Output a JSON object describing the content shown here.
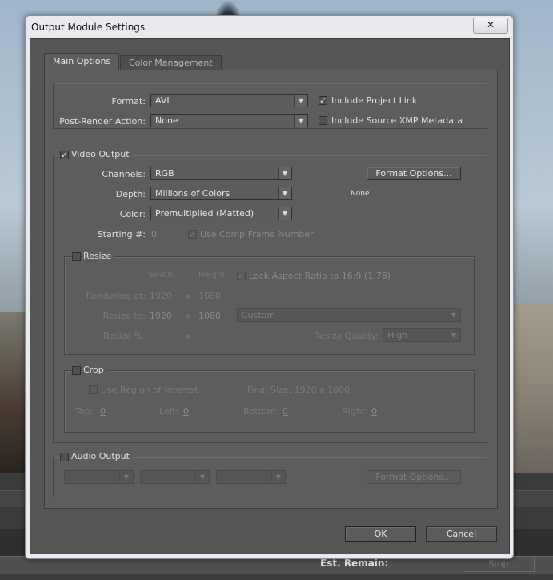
{
  "window": {
    "title": "Output Module Settings",
    "close_label": "✕"
  },
  "tabs": [
    {
      "label": "Main Options"
    },
    {
      "label": "Color Management"
    }
  ],
  "format_section": {
    "format_label": "Format:",
    "format_value": "AVI",
    "post_render_label": "Post-Render Action:",
    "post_render_value": "None",
    "include_project_link_label": "Include Project Link",
    "include_project_link_checked": true,
    "include_xmp_label": "Include Source XMP Metadata",
    "include_xmp_checked": false
  },
  "video_output": {
    "label": "Video Output",
    "checked": true,
    "channels_label": "Channels:",
    "channels_value": "RGB",
    "depth_label": "Depth:",
    "depth_value": "Millions of Colors",
    "color_label": "Color:",
    "color_value": "Premultiplied (Matted)",
    "starting_label": "Starting #:",
    "starting_value": "0",
    "use_comp_frame_label": "Use Comp Frame Number",
    "format_options_label": "Format Options...",
    "codec_value": "None"
  },
  "resize": {
    "label": "Resize",
    "checked": false,
    "width_header": "Width",
    "height_header": "Height",
    "lock_aspect_label": "Lock Aspect Ratio to 16:9 (1.78)",
    "rendering_at_label": "Rendering at:",
    "rendering_w": "1920",
    "rendering_h": "1080",
    "x_sep": "x",
    "resize_to_label": "Resize to:",
    "resize_w": "1920",
    "resize_h": "1080",
    "preset_value": "Custom",
    "resize_pct_label": "Resize %:",
    "quality_label": "Resize Quality:",
    "quality_value": "High"
  },
  "crop": {
    "label": "Crop",
    "checked": false,
    "roi_label": "Use Region of Interest",
    "final_size_label": "Final Size: 1920 x 1080",
    "top_label": "Top:",
    "top_value": "0",
    "left_label": "Left:",
    "left_value": "0",
    "bottom_label": "Bottom:",
    "bottom_value": "0",
    "right_label": "Right:",
    "right_value": "0"
  },
  "audio_output": {
    "label": "Audio Output",
    "checked": false,
    "format_options_label": "Format Options..."
  },
  "buttons": {
    "ok": "OK",
    "cancel": "Cancel"
  },
  "background": {
    "status_text": "Est. Remain:",
    "stop_label": "Stop"
  },
  "icons": {
    "checkmark": "✓",
    "dropdown": "▼"
  }
}
